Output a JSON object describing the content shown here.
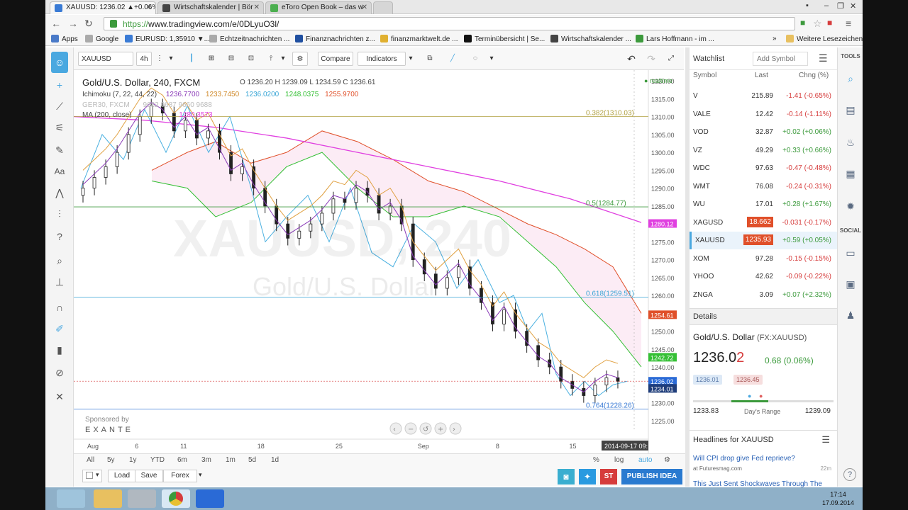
{
  "browser": {
    "tabs": [
      {
        "label": "XAUUSD: 1236.02 ▲+0.06%",
        "active": true
      },
      {
        "label": "Wirtschaftskalender | Bör",
        "active": false
      },
      {
        "label": "eToro Open Book – das w",
        "active": false
      }
    ],
    "url_scheme": "https://",
    "url_rest": "www.tradingview.com/e/0DLyuO3l/",
    "bookmarks": [
      "Apps",
      "Google",
      "EURUSD: 1,35910 ▼...",
      "Echtzeitnachrichten ...",
      "Finanznachrichten z...",
      "finanzmarktwelt.de ...",
      "Terminübersicht | Se...",
      "Wirtschaftskalender ...",
      "Lars Hoffmann - im ...",
      "Weitere Lesezeichen"
    ],
    "overflow": "»"
  },
  "toolbar": {
    "symbol": "XAUUSD",
    "interval": "4h",
    "compare": "Compare",
    "indicators": "Indicators"
  },
  "chart": {
    "title": "Gold/U.S. Dollar, 240, FXCM",
    "ohlc": "O 1236.20  H 1239.09  L 1234.59  C 1236.61",
    "ichimoku_label": "Ichimoku (7, 22, 44, 22)",
    "ichimoku_values": [
      "1236.7700",
      "1233.7450",
      "1236.0200",
      "1248.0375",
      "1255.9700"
    ],
    "ger30_label": "GER30, FXCM",
    "ger30_values": "9682  9687  9660  9688",
    "ma_label": "MA (200, close)",
    "ma_value": "1280.3573",
    "realtime": "realtime",
    "watermark_symbol": "XAUUSD, 240",
    "watermark_name": "Gold/U.S. Dollar",
    "sponsor": "Sponsored by",
    "sponsor_brand": "EXANTE",
    "fib": [
      {
        "label": "0.382(1310.03)",
        "value": 1310.03
      },
      {
        "label": "0.5(1284.77)",
        "value": 1284.77
      },
      {
        "label": "0.618(1259.51)",
        "value": 1259.51
      },
      {
        "label": "0.764(1228.26)",
        "value": 1228.26
      }
    ],
    "price_tags": [
      {
        "text": "1280.12",
        "value": 1280.12,
        "color": "#e040e0"
      },
      {
        "text": "1254.61",
        "value": 1254.61,
        "color": "#e0502a"
      },
      {
        "text": "1242.72",
        "value": 1242.72,
        "color": "#35c035"
      },
      {
        "text": "1236.02",
        "value": 1236.02,
        "color": "#2a6ad6"
      },
      {
        "text": "1234.01",
        "value": 1234.01,
        "color": "#1f3d7a"
      }
    ],
    "price_axis": [
      "1320.00",
      "1315.00",
      "1310.00",
      "1305.00",
      "1300.00",
      "1295.00",
      "1290.00",
      "1285.00",
      "1280.00",
      "1275.00",
      "1270.00",
      "1265.00",
      "1260.00",
      "1255.00",
      "1250.00",
      "1245.00",
      "1240.00",
      "1235.00",
      "1230.00",
      "1225.00"
    ],
    "time_axis": [
      {
        "label": "Aug",
        "x": 0.016
      },
      {
        "label": "6",
        "x": 0.099
      },
      {
        "label": "11",
        "x": 0.178
      },
      {
        "label": "18",
        "x": 0.312
      },
      {
        "label": "25",
        "x": 0.448
      },
      {
        "label": "Sep",
        "x": 0.591
      },
      {
        "label": "8",
        "x": 0.727
      },
      {
        "label": "15",
        "x": 0.855
      }
    ],
    "cursor_time": "2014-09-17 09:",
    "ranges": [
      "All",
      "5y",
      "1y",
      "YTD",
      "6m",
      "3m",
      "1m",
      "5d",
      "1d"
    ],
    "scale_opts": [
      "%",
      "log",
      "auto"
    ]
  },
  "chart_data": {
    "type": "line",
    "title": "Gold/U.S. Dollar, 240, FXCM",
    "x": [
      "Aug 1",
      "Aug 6",
      "Aug 11",
      "Aug 18",
      "Aug 25",
      "Sep 1",
      "Sep 8",
      "Sep 15",
      "Sep 17"
    ],
    "series": [
      {
        "name": "Ichimoku (7, 22, 44, 22)",
        "values": [
          1290,
          1300,
          1305,
          1300,
          1277,
          1285,
          1265,
          1230,
          1236
        ]
      },
      {
        "name": "MA (200, close)",
        "values": [
          1310,
          1308,
          1306,
          1303,
          1298,
          1295,
          1291,
          1284,
          1280.36
        ]
      }
    ],
    "ylim": [
      1222,
      1323
    ],
    "xlabel": "",
    "ylabel": ""
  },
  "bottombar": {
    "load": "Load",
    "save": "Save",
    "forex": "Forex",
    "publish": "PUBLISH IDEA",
    "st": "ST"
  },
  "watchlist": {
    "title": "Watchlist",
    "add_placeholder": "Add Symbol",
    "col_symbol": "Symbol",
    "col_last": "Last",
    "col_chg": "Chng (%)",
    "rows": [
      {
        "sym": "V",
        "last": "215.89",
        "chg": "-1.41 (-0.65%)",
        "dir": "neg"
      },
      {
        "sym": "VALE",
        "last": "12.42",
        "chg": "-0.14 (-1.11%)",
        "dir": "neg"
      },
      {
        "sym": "VOD",
        "last": "32.87",
        "chg": "+0.02 (+0.06%)",
        "dir": "pos"
      },
      {
        "sym": "VZ",
        "last": "49.29",
        "chg": "+0.33 (+0.66%)",
        "dir": "pos"
      },
      {
        "sym": "WDC",
        "last": "97.63",
        "chg": "-0.47 (-0.48%)",
        "dir": "neg"
      },
      {
        "sym": "WMT",
        "last": "76.08",
        "chg": "-0.24 (-0.31%)",
        "dir": "neg"
      },
      {
        "sym": "WU",
        "last": "17.01",
        "chg": "+0.28 (+1.67%)",
        "dir": "pos"
      },
      {
        "sym": "XAGUSD",
        "last": "18.662",
        "chg": "-0.031 (-0.17%)",
        "dir": "neg",
        "badge": "#e0502a"
      },
      {
        "sym": "XAUUSD",
        "last": "1235.93",
        "chg": "+0.59 (+0.05%)",
        "dir": "pos",
        "badge": "#e0502a",
        "selected": true
      },
      {
        "sym": "XOM",
        "last": "97.28",
        "chg": "-0.15 (-0.15%)",
        "dir": "neg"
      },
      {
        "sym": "YHOO",
        "last": "42.62",
        "chg": "-0.09 (-0.22%)",
        "dir": "neg"
      },
      {
        "sym": "ZNGA",
        "last": "3.09",
        "chg": "+0.07 (+2.32%)",
        "dir": "pos"
      }
    ]
  },
  "details": {
    "title": "Details",
    "name": "Gold/U.S. Dollar",
    "exchange": "(FX:XAUUSD)",
    "price_main": "1236.0",
    "price_last": "2",
    "change": "0.68 (0.06%)",
    "bid": "1236.01",
    "ask": "1236.45",
    "low": "1233.83",
    "range_label": "Day's Range",
    "high": "1239.09"
  },
  "headlines": {
    "title": "Headlines for XAUUSD",
    "items": [
      {
        "text": "Will CPI drop give Fed reprieve?",
        "source": "at Futuresmag.com",
        "time": "22m"
      },
      {
        "text": "This Just Sent Shockwaves Through The",
        "source": "",
        "time": ""
      }
    ]
  },
  "right_tools": {
    "tools_label": "TOOLS",
    "social_label": "SOCIAL"
  },
  "taskbar": {
    "time": "17:14",
    "date": "17.09.2014"
  }
}
